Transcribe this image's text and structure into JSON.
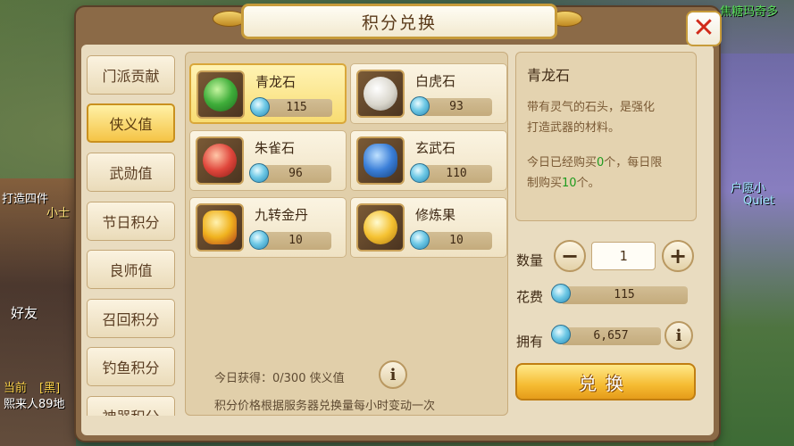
{
  "window": {
    "title": "积分兑换",
    "close_icon": "close-icon"
  },
  "tabs": [
    {
      "label": "门派贡献"
    },
    {
      "label": "侠义值",
      "active": true
    },
    {
      "label": "武勋值"
    },
    {
      "label": "节日积分"
    },
    {
      "label": "良师值"
    },
    {
      "label": "召回积分"
    },
    {
      "label": "钓鱼积分"
    },
    {
      "label": "神器积分"
    }
  ],
  "items": [
    {
      "name": "青龙石",
      "price": "115",
      "icon": "green-dragon-stone-icon",
      "color": "#3fae3a",
      "selected": true
    },
    {
      "name": "白虎石",
      "price": "93",
      "icon": "white-tiger-stone-icon",
      "color": "#d9d6cc"
    },
    {
      "name": "朱雀石",
      "price": "96",
      "icon": "vermilion-bird-stone-icon",
      "color": "#e0473c"
    },
    {
      "name": "玄武石",
      "price": "110",
      "icon": "black-tortoise-stone-icon",
      "color": "#3b7fd8"
    },
    {
      "name": "九转金丹",
      "price": "10",
      "icon": "golden-elixir-icon",
      "color": "#f0b21e"
    },
    {
      "name": "修炼果",
      "price": "10",
      "icon": "cultivation-fruit-icon",
      "color": "#f5c232"
    }
  ],
  "footer": {
    "today_gain": "今日获得：0/300 侠义值",
    "note": "积分价格根据服务器兑换量每小时变动一次"
  },
  "detail": {
    "name": "青龙石",
    "description_line1": "带有灵气的石头，是强化",
    "description_line2": "打造武器的材料。",
    "daily_prefix": "今日已经购买",
    "daily_bought": "0",
    "daily_mid": "个，每日限",
    "daily_limit_prefix": "制购买",
    "daily_limit": "10",
    "daily_suffix": "个。"
  },
  "purchase": {
    "quantity_label": "数量",
    "quantity": "1",
    "cost_label": "花费",
    "cost": "115",
    "owned_label": "拥有",
    "owned": "6,657",
    "exchange_label": "兑换"
  },
  "background": {
    "top_right_text": "焦糖玛奇多",
    "left_text_1": "打造四件",
    "left_text_2": "小士",
    "left_text_3": "好友",
    "left_text_4": "当前",
    "left_text_5": "[黑]",
    "left_text_6": "熙来人89地",
    "right_text_1": "Quiet",
    "right_text_2": "户愿小"
  }
}
